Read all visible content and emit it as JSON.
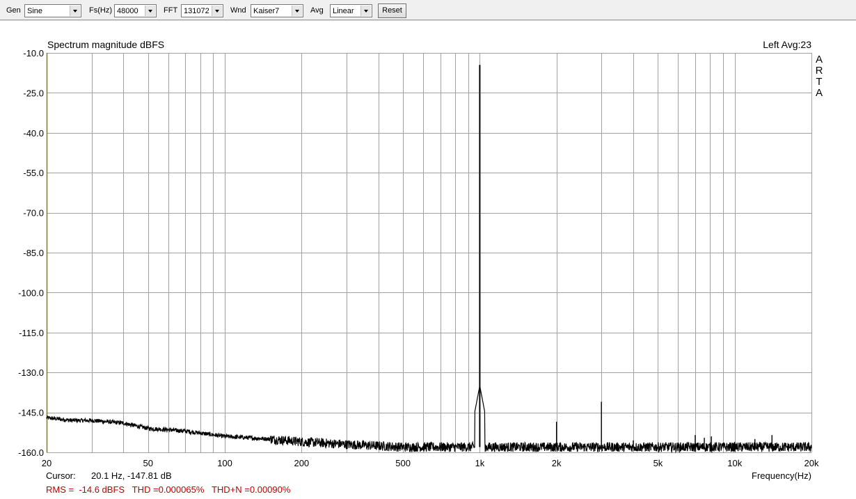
{
  "toolbar": {
    "gen_label": "Gen",
    "gen_value": "Sine",
    "fs_label": "Fs(Hz)",
    "fs_value": "48000",
    "fft_label": "FFT",
    "fft_value": "131072",
    "wnd_label": "Wnd",
    "wnd_value": "Kaiser7",
    "avg_label": "Avg",
    "avg_value": "Linear",
    "reset_label": "Reset"
  },
  "plot": {
    "title": "Spectrum magnitude dBFS",
    "channel_label": "Left  Avg:23",
    "brand_letters": [
      "A",
      "R",
      "T",
      "A"
    ],
    "cursor_label": "Cursor:",
    "cursor_value": "20.1 Hz, -147.81 dB",
    "stats": "RMS =  -14.6 dBFS   THD =0.000065%   THD+N =0.00090%",
    "xaxis_label": "Frequency(Hz)"
  },
  "colors": {
    "trace": "#000000",
    "grid": "#a0a0a0",
    "stats_text": "#c00000",
    "left_axis": "#808000"
  },
  "chart_data": {
    "type": "line",
    "title": "Spectrum magnitude dBFS",
    "xlabel": "Frequency(Hz)",
    "ylabel": "",
    "xscale": "log",
    "xlim": [
      20,
      20000
    ],
    "ylim": [
      -160,
      -10
    ],
    "grid": true,
    "yticks": [
      -10,
      -25,
      -40,
      -55,
      -70,
      -85,
      -100,
      -115,
      -130,
      -145,
      -160
    ],
    "ytick_labels": [
      "-10.0",
      "-25.0",
      "-40.0",
      "-55.0",
      "-70.0",
      "-85.0",
      "-100.0",
      "-115.0",
      "-130.0",
      "-145.0",
      "-160.0"
    ],
    "xticks": [
      20,
      50,
      100,
      200,
      500,
      1000,
      2000,
      5000,
      10000,
      20000
    ],
    "xtick_labels": [
      "20",
      "50",
      "100",
      "200",
      "500",
      "1k",
      "2k",
      "5k",
      "10k",
      "20k"
    ],
    "noise_floor": {
      "x": [
        20,
        25,
        30,
        40,
        50,
        70,
        100,
        150,
        200,
        300,
        500,
        700,
        900,
        1100,
        2000,
        5000,
        10000,
        20000
      ],
      "y": [
        -147,
        -148,
        -148,
        -149,
        -151,
        -152,
        -154,
        -155,
        -156,
        -157,
        -158,
        -158,
        -158,
        -158,
        -158,
        -158,
        -158,
        -158
      ]
    },
    "peaks": [
      {
        "x": 1000,
        "y": -14.5
      },
      {
        "x": 2000,
        "y": -148.5
      },
      {
        "x": 3000,
        "y": -141.0
      },
      {
        "x": 4000,
        "y": -155.5
      },
      {
        "x": 7000,
        "y": -153.5
      },
      {
        "x": 7600,
        "y": -154.5
      },
      {
        "x": 8100,
        "y": -154.0
      },
      {
        "x": 12000,
        "y": -155.0
      },
      {
        "x": 14000,
        "y": -153.5
      }
    ]
  }
}
